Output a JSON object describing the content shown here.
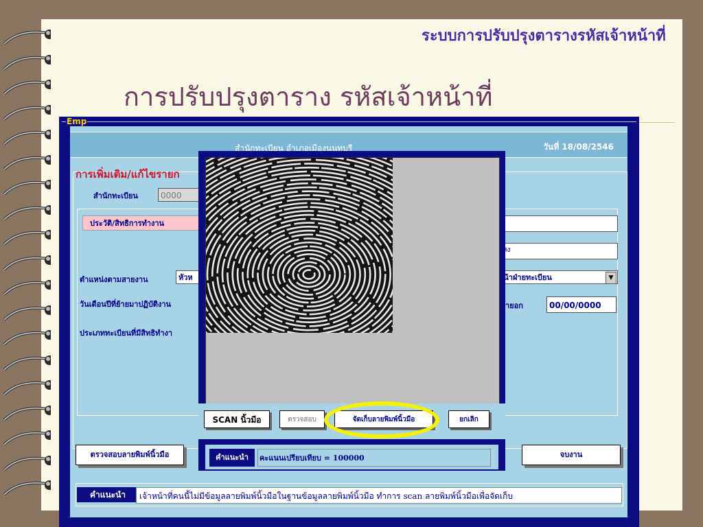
{
  "slide": {
    "header_title": "ระบบการปรับปรุงตารางรหัสเจ้าหน้าที่",
    "title": "การปรับปรุงตาราง รหัสเจ้าหน้าที่"
  },
  "window": {
    "title": "Emp",
    "office": "สำนักทะเบียน อำเภอเมืองนนทบุรี",
    "date": "วันที่ 18/08/2546",
    "section_title": "การเพิ่มเติม/แก้ไขรายก",
    "fields": {
      "registry_label": "สำนักทะเบียน",
      "registry_value": "0000",
      "tab_label": "ประวัติ/สิทธิการทำงาน",
      "position_label": "ตำแหน่งตามสายงาน",
      "position_value": "หัวห",
      "move_date_label": "วันเดือนปีที่ย้ายมาปฏิบัติงาน",
      "registry_type_label": "ประเภททะเบียนที่มีสิทธิทำงา",
      "name_tail": "แสง",
      "department_value": "หน้าฝ่ายทะเบียน",
      "leave_label": "ายอก",
      "leave_date": "00/00/0000"
    },
    "buttons": {
      "check_fingerprint": "ตรวจสอบลายพิมพ์นิ้วมือ",
      "finish": "จบงาน"
    },
    "hint_label": "คำแนะนำ",
    "hint_text": "เจ้าหน้าที่คนนี้ไม่มีข้อมูลลายพิมพ์นิ้วมือในฐานข้อมูลลายพิมพ์นิ้วมือ  ทำการ scan ลายพิมพ์นิ้วมือเพื่อจัดเก็บ"
  },
  "scanner": {
    "buttons": {
      "scan": "SCAN นิ้วมือ",
      "verify": "ตรวจสอบ",
      "store": "จัดเก็บลายพิมพ์นิ้วมือ",
      "cancel": "ยกเลิก"
    },
    "hint_label": "คำแนะนำ",
    "hint_text": "คะแนนเปรียบเทียบ = 100000"
  },
  "colors": {
    "window_navy": "#0b0c82",
    "panel_blue": "#a8d2e6",
    "highlight": "#f7f200",
    "accent_red": "#d0142a"
  }
}
